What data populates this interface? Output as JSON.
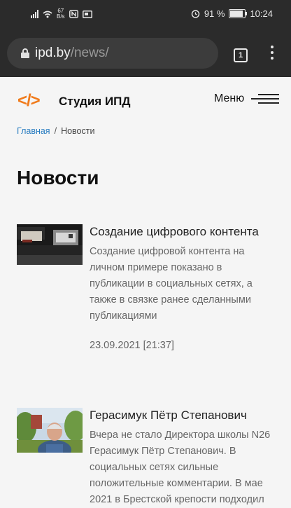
{
  "status_bar": {
    "net_speed_value": "67",
    "net_speed_unit": "B/s",
    "battery": "91 %",
    "battery_level": 0.91,
    "time": "10:24"
  },
  "browser": {
    "url_host": "ipd.by",
    "url_path": "/news/",
    "tab_count": "1"
  },
  "header": {
    "logo_icon": "</>",
    "logo_text": "Студия ИПД",
    "menu_label": "Меню",
    "accent_color": "#f07a1a"
  },
  "breadcrumb": {
    "home": "Главная",
    "separator": "/",
    "current": "Новости"
  },
  "page_title": "Новости",
  "news": [
    {
      "title": "Создание цифрового контента",
      "excerpt": "Создание цифровой контента на личном примере показано в публикации в социальных сетях, а также в связке ранее сделанными публикациями",
      "date": "23.09.2021 [21:37]"
    },
    {
      "title": "Герасимук Пётр Степанович",
      "excerpt": "Вчера не стало Директора школы N26 Герасимук Пётр Степанович. В социальных сетях сильные положительные комментарии. В мае 2021 в Брестской крепости подходил"
    }
  ]
}
